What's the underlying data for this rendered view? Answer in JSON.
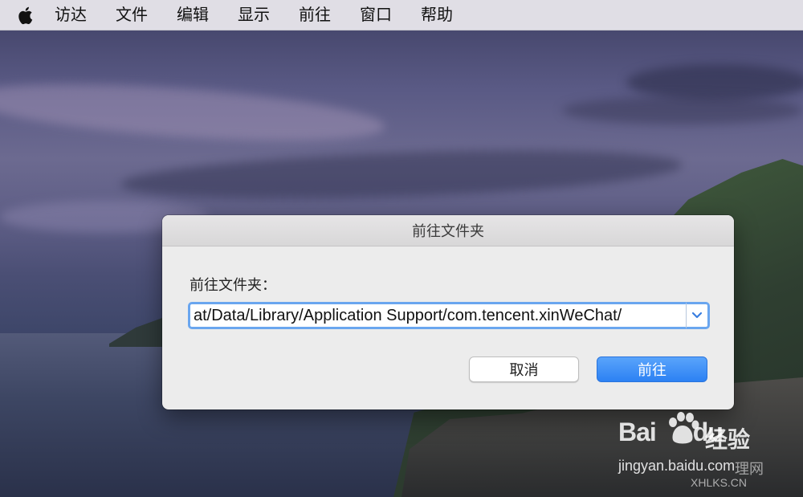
{
  "menubar": {
    "apple_icon": "apple-logo-icon",
    "items": [
      "访达",
      "文件",
      "编辑",
      "显示",
      "前往",
      "窗口",
      "帮助"
    ]
  },
  "dialog": {
    "title": "前往文件夹",
    "prompt": "前往文件夹：",
    "path_value": "at/Data/Library/Application Support/com.tencent.xinWeChat/",
    "dropdown_icon": "chevron-down-icon",
    "cancel_label": "取消",
    "go_label": "前往"
  },
  "colors": {
    "accent": "#3184f4",
    "focus_ring": "#6aa6ef"
  },
  "watermark": {
    "brand": "Bai",
    "brand_tail": "du",
    "jingyan": "经验",
    "url": "jingyan.baidu.com",
    "site": "XHLKS.CN",
    "site_cn": "理网"
  }
}
